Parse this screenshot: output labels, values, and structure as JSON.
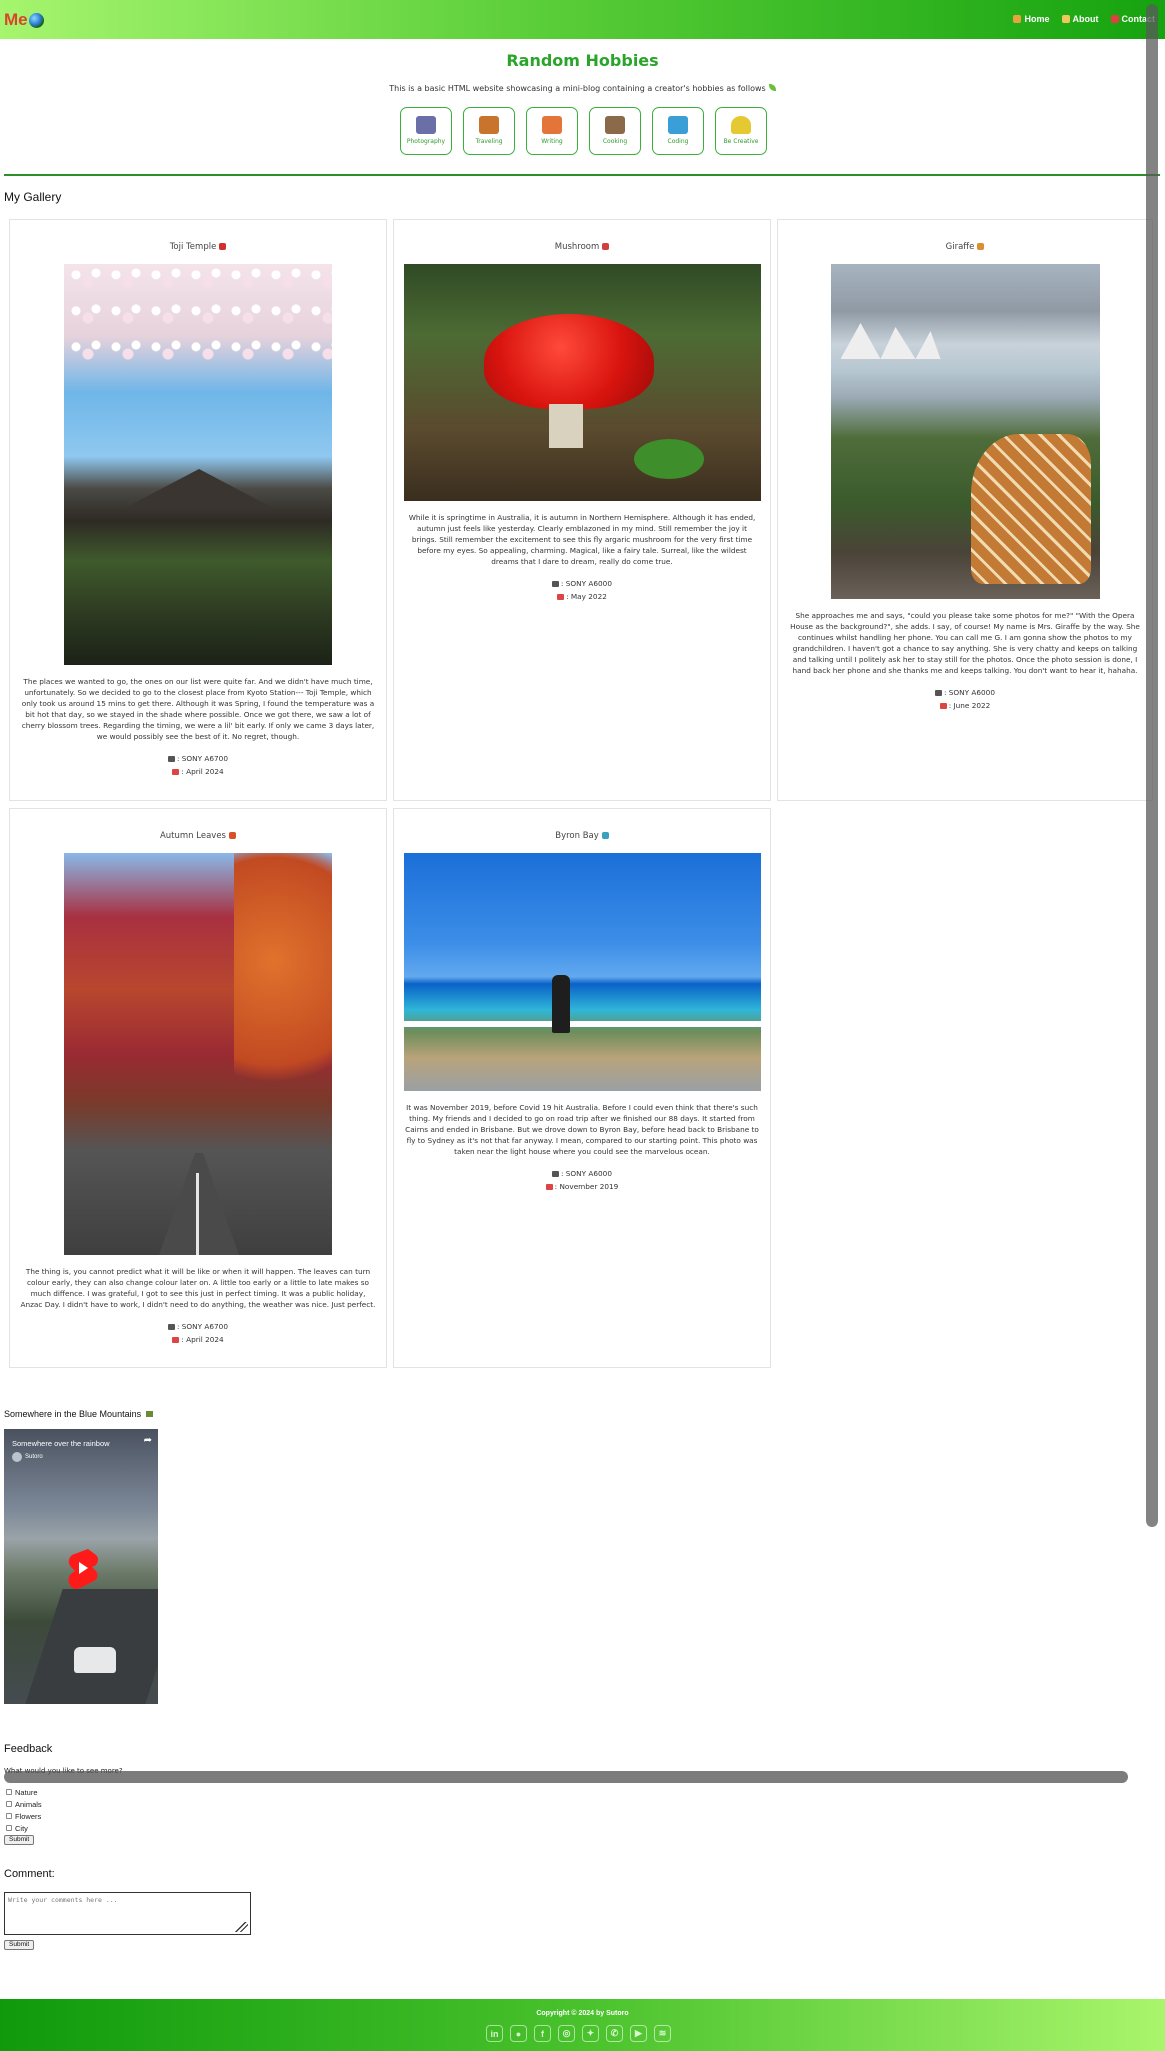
{
  "header": {
    "logo_text": "Me",
    "nav": [
      {
        "label": "Home",
        "icon": "home-icon",
        "color": "#e8a33c"
      },
      {
        "label": "About",
        "icon": "person-icon",
        "color": "#f0c75a"
      },
      {
        "label": "Contact",
        "icon": "mail-icon",
        "color": "#e04040"
      }
    ]
  },
  "intro": {
    "title": "Random Hobbies",
    "subtitle": "This is a basic HTML website showcasing a mini-blog containing a creator's hobbies as follows"
  },
  "hobbies": [
    {
      "label": "Photography",
      "icon": "camera-icon",
      "color": "#6a6fa8"
    },
    {
      "label": "Traveling",
      "icon": "backpack-icon",
      "color": "#c9742c"
    },
    {
      "label": "Writing",
      "icon": "writing-hand-icon",
      "color": "#e4753a"
    },
    {
      "label": "Cooking",
      "icon": "cooking-pot-icon",
      "color": "#8b6a4a"
    },
    {
      "label": "Coding",
      "icon": "laptop-icon",
      "color": "#3a9fd6"
    },
    {
      "label": "Be Creative",
      "icon": "lightbulb-icon",
      "color": "#e5c932"
    }
  ],
  "gallery": {
    "heading": "My Gallery",
    "cards": [
      {
        "title": "Toji Temple",
        "emoji": "torii-icon",
        "emoji_color": "#d03030",
        "desc": "The places we wanted to go, the ones on our list were quite far. And we didn't have much time, unfortunately. So we decided to go to the closest place from Kyoto Station--- Toji Temple, which only took us around 15 mins to get there. Although it was Spring, I found the temperature was a bit hot that day, so we stayed in the shade where possible. Once we got there, we saw a lot of cherry blossom trees. Regarding the timing, we were a lil' bit early. If only we came 3 days later, we would possibly see the best of it. No regret, though.",
        "camera": ": SONY A6700",
        "date": ": April 2024"
      },
      {
        "title": "Mushroom",
        "emoji": "mushroom-icon",
        "emoji_color": "#d04040",
        "desc": "While it is springtime in Australia, it is autumn in Northern Hemisphere. Although it has ended, autumn just feels like yesterday. Clearly emblazoned in my mind. Still remember the joy it brings. Still remember the excitement to see this fly argaric mushroom for the very first time before my eyes. So appealing, charming. Magical, like a fairy tale. Surreal, like the wildest dreams that I dare to dream, really do come true.",
        "camera": ": SONY A6000",
        "date": ": May 2022"
      },
      {
        "title": "Giraffe",
        "emoji": "giraffe-icon",
        "emoji_color": "#d89030",
        "desc": "She approaches me and says, \"could you please take some photos for me?\" \"With the Opera House as the background?\", she adds. I say, of course! My name is Mrs. Giraffe by the way. She continues whilst handling her phone. You can call me G. I am gonna show the photos to my grandchildren. I haven't got a chance to say anything. She is very chatty and keeps on talking and talking until I politely ask her to stay still for the photos. Once the photo session is done, I hand back her phone and she thanks me and keeps talking. You don't want to hear it, hahaha.",
        "camera": ": SONY A6000",
        "date": ": June 2022"
      },
      {
        "title": "Autumn Leaves",
        "emoji": "maple-leaf-icon",
        "emoji_color": "#d8502a",
        "desc": "The thing is, you cannot predict what it will be like or when it will happen. The leaves can turn colour early, they can also change colour later on. A little too early or a little to late makes so much diffence. I was grateful, I got to see this just in perfect timing. It was a public holiday, Anzac Day. I didn't have to work, I didn't need to do anything, the weather was nice. Just perfect.",
        "camera": ": SONY A6700",
        "date": ": April 2024"
      },
      {
        "title": "Byron Bay",
        "emoji": "surfboard-icon",
        "emoji_color": "#3aa0c0",
        "desc": "It was November 2019, before Covid 19 hit Australia. Before I could even think that there's such thing. My friends and I decided to go on road trip after we finished our 88 days. It started from Cairns and ended in Brisbane. But we drove down to Byron Bay, before head back to Brisbane to fly to Sydney as it's not that far anyway. I mean, compared to our starting point. This photo was taken near the light house where you could see the marvelous ocean.",
        "camera": ": SONY A6000",
        "date": ": November 2019"
      }
    ]
  },
  "video_section": {
    "heading": "Somewhere in the Blue Mountains",
    "video_title": "Somewhere over the rainbow",
    "channel": "Sutoro"
  },
  "feedback": {
    "heading": "Feedback",
    "question": "What would you like to see more?",
    "options": [
      "Nature",
      "Animals",
      "Flowers",
      "City"
    ],
    "submit_label": "Submit"
  },
  "comment": {
    "heading": "Comment:",
    "placeholder": "Write your comments here ...",
    "submit_label": "Submit"
  },
  "footer": {
    "copyright": "Copyright © 2024 by Sutoro",
    "socials": [
      {
        "icon": "linkedin-icon",
        "glyph": "in"
      },
      {
        "icon": "github-icon",
        "glyph": "●"
      },
      {
        "icon": "facebook-icon",
        "glyph": "f"
      },
      {
        "icon": "instagram-icon",
        "glyph": "◎"
      },
      {
        "icon": "twitter-icon",
        "glyph": "✦"
      },
      {
        "icon": "whatsapp-icon",
        "glyph": "✆"
      },
      {
        "icon": "youtube-icon",
        "glyph": "▶"
      },
      {
        "icon": "spotify-icon",
        "glyph": "≋"
      }
    ]
  }
}
